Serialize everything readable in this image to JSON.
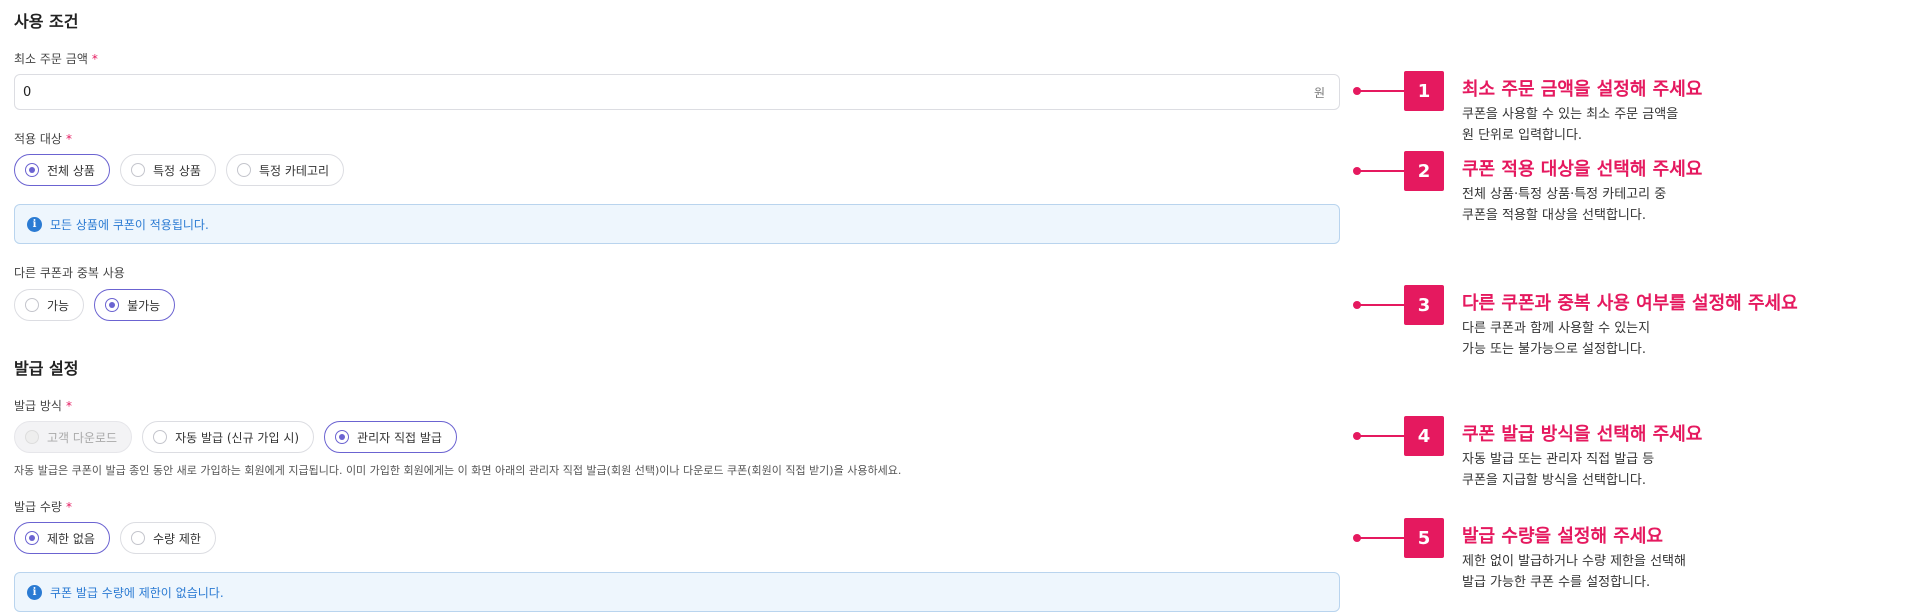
{
  "usage": {
    "section_title": "사용 조건",
    "min_order": {
      "label": "최소 주문 금액",
      "required": "*",
      "value": "0",
      "unit": "원"
    },
    "target": {
      "label": "적용 대상",
      "required": "*",
      "options": [
        "전체 상품",
        "특정 상품",
        "특정 카테고리"
      ],
      "selected": "전체 상품",
      "info": "모든 상품에 쿠폰이 적용됩니다."
    },
    "duplicate": {
      "label": "다른 쿠폰과 중복 사용",
      "options": [
        "가능",
        "불가능"
      ],
      "selected": "불가능"
    }
  },
  "issue": {
    "section_title": "발급 설정",
    "method": {
      "label": "발급 방식",
      "required": "*",
      "options": [
        "고객 다운로드",
        "자동 발급 (신규 가입 시)",
        "관리자 직접 발급"
      ],
      "selected": "관리자 직접 발급",
      "disabled": "고객 다운로드",
      "help": "자동 발급은 쿠폰이 발급 종인 동안 새로 가입하는 회원에게 지급됩니다. 이미 가입한 회원에게는 이 화면 아래의 관리자 직접 발급(회원 선택)이나 다운로드 쿠폰(회원이 직접 받기)을 사용하세요."
    },
    "quantity": {
      "label": "발급 수량",
      "required": "*",
      "options": [
        "제한 없음",
        "수량 제한"
      ],
      "selected": "제한 없음",
      "info": "쿠폰 발급 수량에 제한이 없습니다."
    }
  },
  "annotations": [
    {
      "number": "1",
      "title": "최소 주문 금액을 설정해 주세요",
      "lines": [
        "쿠폰을 사용할 수 있는 최소 주문 금액을",
        "원 단위로 입력합니다."
      ]
    },
    {
      "number": "2",
      "title": "쿠폰 적용 대상을 선택해 주세요",
      "lines": [
        "전체 상품·특정 상품·특정 카테고리 중",
        "쿠폰을 적용할 대상을 선택합니다."
      ]
    },
    {
      "number": "3",
      "title": "다른 쿠폰과 중복 사용 여부를 설정해 주세요",
      "lines": [
        "다른 쿠폰과 함께 사용할 수 있는지",
        "가능 또는 불가능으로 설정합니다."
      ]
    },
    {
      "number": "4",
      "title": "쿠폰 발급 방식을 선택해 주세요",
      "lines": [
        "자동 발급 또는 관리자 직접 발급 등",
        "쿠폰을 지급할 방식을 선택합니다."
      ]
    },
    {
      "number": "5",
      "title": "발급 수량을 설정해 주세요",
      "lines": [
        "제한 없이 발급하거나 수량 제한을 선택해",
        "발급 가능한 쿠폰 수를 설정합니다."
      ]
    }
  ],
  "colors": {
    "accent": "#e5195f",
    "radio": "#6b63d1",
    "info": "#2b7bd3"
  }
}
